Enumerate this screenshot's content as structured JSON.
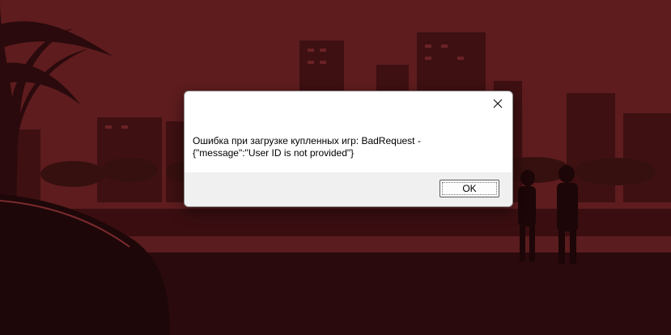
{
  "dialog": {
    "title": "",
    "message": "Ошибка при загрузке купленных игр: BadRequest - {\"message\":\"User ID is not provided\"}",
    "ok_label": "OK",
    "close_icon": "close-icon"
  },
  "colors": {
    "backdrop_top": "#5a1a1c",
    "backdrop_bottom": "#2a0a0c",
    "dialog_bg": "#ffffff",
    "footer_bg": "#f0f0f0"
  }
}
